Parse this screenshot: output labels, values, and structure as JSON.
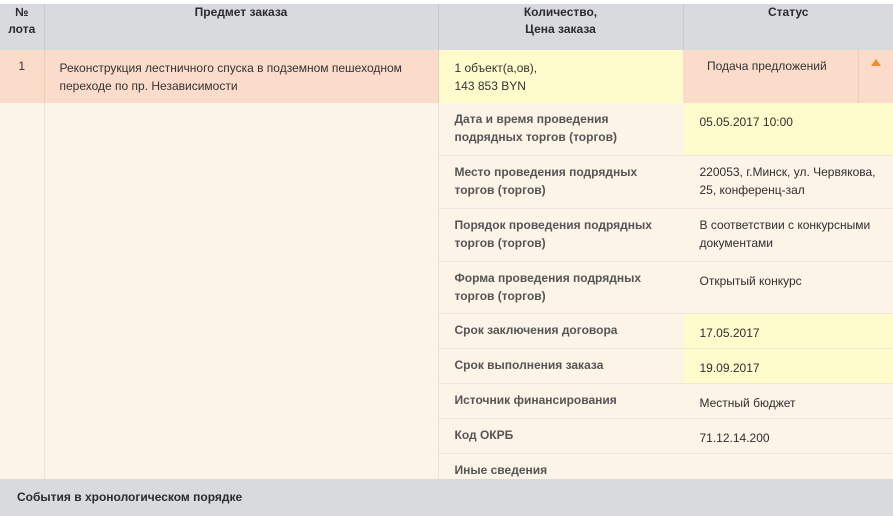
{
  "header": {
    "col_num": [
      "№",
      "лота"
    ],
    "col_subject": "Предмет заказа",
    "col_qty": [
      "Количество,",
      "Цена заказа"
    ],
    "col_status": "Статус"
  },
  "lot": {
    "number": "1",
    "subject": [
      "Реконструкция лестничного спуска в подземном пешеходном",
      "переходе по пр. Независимости"
    ],
    "qty": [
      "1 объект(а,ов),",
      "143 853 BYN"
    ],
    "status": "Подача предложений",
    "collapse_icon": "triangle-up-icon"
  },
  "details": [
    {
      "label": [
        "Дата и время проведения",
        "подрядных торгов (торгов)"
      ],
      "value": [
        "05.05.2017 10:00"
      ],
      "highlight": true
    },
    {
      "label": [
        "Место проведения подрядных",
        "торгов (торгов)"
      ],
      "value": [
        "220053, г.Минск, ул. Червякова,",
        "25, конференц-зал"
      ],
      "highlight": false
    },
    {
      "label": [
        "Порядок проведения подрядных",
        "торгов (торгов)"
      ],
      "value": [
        "В соответствии с конкурсными",
        "документами"
      ],
      "highlight": false
    },
    {
      "label": [
        "Форма проведения подрядных",
        "торгов (торгов)"
      ],
      "value": [
        "Открытый конкурс"
      ],
      "highlight": false
    },
    {
      "label": [
        "Срок заключения договора"
      ],
      "value": [
        "17.05.2017"
      ],
      "highlight": true
    },
    {
      "label": [
        "Срок выполнения заказа"
      ],
      "value": [
        "19.09.2017"
      ],
      "highlight": true
    },
    {
      "label": [
        "Источник финансирования"
      ],
      "value": [
        "Местный бюджет"
      ],
      "highlight": false
    },
    {
      "label": [
        "Код ОКРБ"
      ],
      "value": [
        "71.12.14.200"
      ],
      "highlight": false
    },
    {
      "label": [
        "Иные сведения"
      ],
      "value": [
        ""
      ],
      "highlight": false
    }
  ],
  "events_title": "События в хронологическом порядке",
  "colors": {
    "header_bg": "#d9dade",
    "lot_row_bg": "#fbdccb",
    "detail_bg": "#fdf4e8",
    "highlight_bg": "#fefccd",
    "accent_arrow": "#f28a2e"
  }
}
